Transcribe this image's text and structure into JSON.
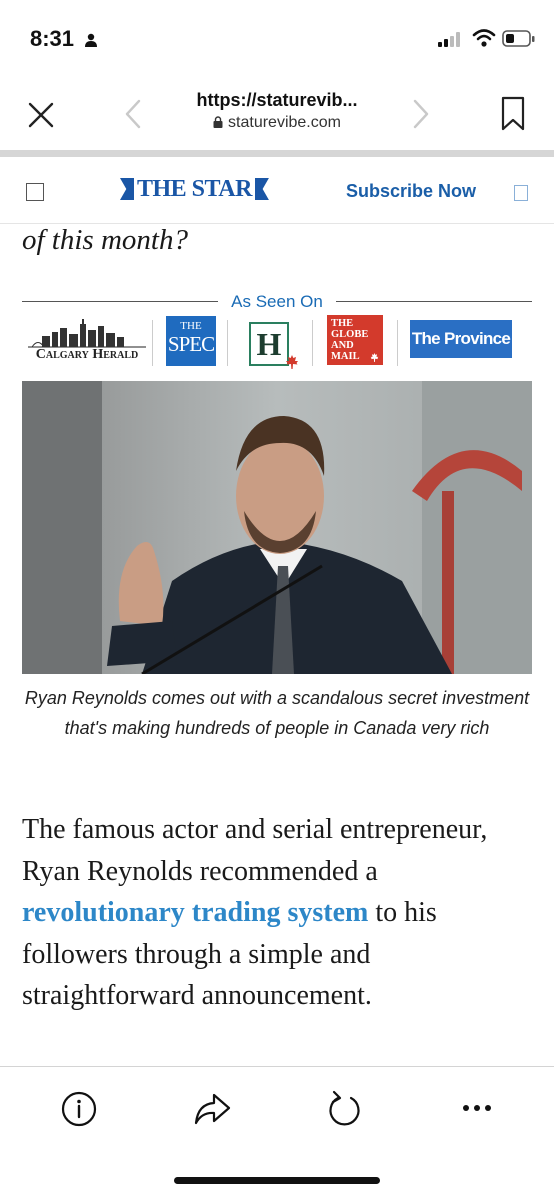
{
  "status_bar": {
    "time": "8:31"
  },
  "browser": {
    "url_title": "https://staturevib...",
    "url_host": "staturevibe.com"
  },
  "site_header": {
    "logo": "THE STAR",
    "subscribe_label": "Subscribe Now"
  },
  "article": {
    "partial_heading": "of this month?",
    "as_seen_on_label": "As Seen On",
    "publications": {
      "calgary_herald": "Calgary Herald",
      "spec_the": "THE",
      "spec_name": "SPEC",
      "hamilton": "H",
      "globe": "THE\nGLOBE\nAND\nMAIL",
      "province": "The Province"
    },
    "image_caption": "Ryan Reynolds comes out with a scandalous secret investment that's making hundreds of people in Canada very rich",
    "paragraph_before": "The famous actor and serial entrepreneur, Ryan Reynolds recommended a ",
    "paragraph_link": "revolutionary trading system",
    "paragraph_after": " to his followers through a simple and straightforward announcement."
  },
  "colors": {
    "brand_blue": "#1a56a6",
    "link_blue": "#2d87c8",
    "globe_red": "#d33a2c"
  },
  "icons": {
    "status": [
      "person-icon",
      "signal-icon",
      "wifi-icon",
      "battery-icon"
    ],
    "browser": [
      "close-icon",
      "back-chevron-icon",
      "forward-chevron-icon",
      "lock-icon",
      "bookmark-icon"
    ],
    "toolbar": [
      "info-icon",
      "share-icon",
      "reload-icon",
      "more-icon"
    ]
  }
}
